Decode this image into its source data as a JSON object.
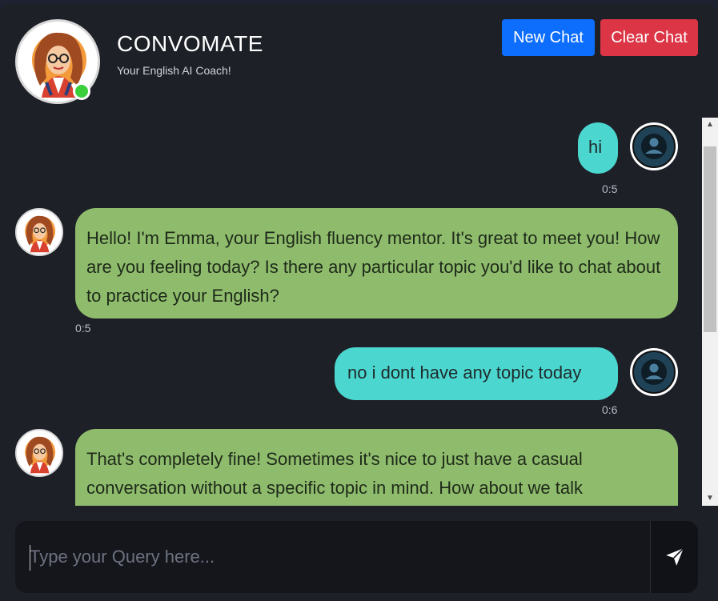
{
  "header": {
    "title": "CONVOMATE",
    "subtitle": "Your English AI Coach!",
    "new_chat_label": "New Chat",
    "clear_chat_label": "Clear Chat"
  },
  "messages": [
    {
      "sender": "user",
      "text": "hi",
      "time": "0:5"
    },
    {
      "sender": "bot",
      "text": "Hello! I'm Emma, your English fluency mentor. It's great to meet you! How are you feeling today? Is there any particular topic you'd like to chat about to practice your English?",
      "time": "0:5"
    },
    {
      "sender": "user",
      "text": "no i dont have any topic today",
      "time": "0:6"
    },
    {
      "sender": "bot",
      "text": "That's completely fine! Sometimes it's nice to just have a casual conversation without a specific topic in mind. How about we talk"
    }
  ],
  "input": {
    "placeholder": "Type your Query here..."
  },
  "icons": {
    "send": "paper-plane-icon",
    "user_avatar": "user-icon",
    "bot_avatar": "emma-avatar-icon"
  },
  "colors": {
    "new_chat": "#0d6efd",
    "clear_chat": "#dc3545",
    "user_bubble": "#4cd6d0",
    "bot_bubble": "#8fbc6c",
    "online": "#3ccf3c"
  }
}
